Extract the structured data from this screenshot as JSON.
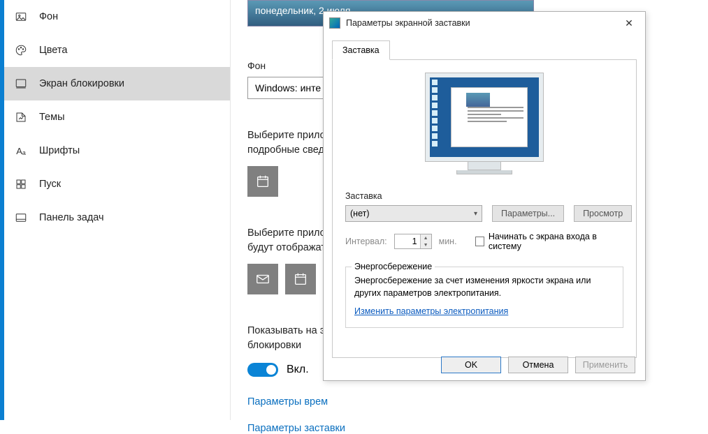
{
  "sidebar": {
    "items": [
      {
        "label": "Фон",
        "icon": "image-icon"
      },
      {
        "label": "Цвета",
        "icon": "palette-icon"
      },
      {
        "label": "Экран блокировки",
        "icon": "lock-screen-icon"
      },
      {
        "label": "Темы",
        "icon": "themes-icon"
      },
      {
        "label": "Шрифты",
        "icon": "fonts-icon"
      },
      {
        "label": "Пуск",
        "icon": "start-icon"
      },
      {
        "label": "Панель задач",
        "icon": "taskbar-icon"
      }
    ],
    "selected_index": 2
  },
  "main": {
    "preview_date": "понедельник, 2 июля",
    "section_background_label": "Фон",
    "background_combo_value": "Windows: инте",
    "choose_app_text": "Выберите прило\nподробные свед",
    "tile_calendar": "calendar-icon",
    "choose_apps_text2": "Выберите прило\nбудут отображат",
    "tile_icons": [
      "mail-icon",
      "calendar-icon",
      "app-icon"
    ],
    "show_on_lock_text": "Показывать на э\nблокировки",
    "toggle_state": "Вкл.",
    "link_time": "Параметры врем",
    "link_screensaver": "Параметры заставки"
  },
  "dialog": {
    "title": "Параметры экранной заставки",
    "tab_label": "Заставка",
    "screensaver_label": "Заставка",
    "screensaver_value": "(нет)",
    "btn_params": "Параметры...",
    "btn_preview": "Просмотр",
    "interval_label": "Интервал:",
    "interval_value": "1",
    "interval_unit": "мин.",
    "checkbox_label": "Начинать с экрана входа в систему",
    "power_legend": "Энергосбережение",
    "power_text": "Энергосбережение за счет изменения яркости экрана или других параметров электропитания.",
    "power_link": "Изменить параметры электропитания",
    "btn_ok": "OK",
    "btn_cancel": "Отмена",
    "btn_apply": "Применить"
  }
}
